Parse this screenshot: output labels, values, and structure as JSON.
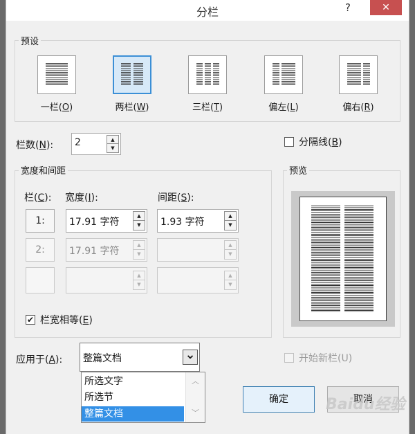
{
  "window": {
    "title": "分栏",
    "help_icon": "?",
    "close_icon": "✕"
  },
  "presets": {
    "group_label": "预设",
    "items": [
      {
        "label": "一栏(",
        "key": "O",
        "suffix": ")"
      },
      {
        "label": "两栏(",
        "key": "W",
        "suffix": ")"
      },
      {
        "label": "三栏(",
        "key": "T",
        "suffix": ")"
      },
      {
        "label": "偏左(",
        "key": "L",
        "suffix": ")"
      },
      {
        "label": "偏右(",
        "key": "R",
        "suffix": ")"
      }
    ],
    "selected": "两栏"
  },
  "columns_count": {
    "label": "栏数(",
    "key": "N",
    "suffix": "):",
    "value": "2"
  },
  "divider": {
    "label": "分隔线(",
    "key": "B",
    "suffix": ")",
    "checked": false
  },
  "width_spacing": {
    "group_label": "宽度和间距",
    "col_header": {
      "label": "栏(",
      "key": "C",
      "suffix": "):"
    },
    "width_header": {
      "label": "宽度(",
      "key": "I",
      "suffix": "):"
    },
    "spacing_header": {
      "label": "间距(",
      "key": "S",
      "suffix": "):"
    },
    "rows": [
      {
        "num": "1:",
        "width": "17.91 字符",
        "spacing": "1.93 字符"
      },
      {
        "num": "2:",
        "width": "17.91 字符",
        "spacing": ""
      },
      {
        "num": "",
        "width": "",
        "spacing": ""
      }
    ]
  },
  "equal_width": {
    "label": "栏宽相等(",
    "key": "E",
    "suffix": ")",
    "checked": true,
    "check_glyph": "✔"
  },
  "preview": {
    "label": "预览"
  },
  "apply_to": {
    "label": "应用于(",
    "key": "A",
    "suffix": "):",
    "value": "整篇文档",
    "options": [
      "所选文字",
      "所选节",
      "整篇文档"
    ],
    "arrow_glyph": "⌄"
  },
  "new_column": {
    "label": "开始新栏(U)",
    "checked": false
  },
  "buttons": {
    "ok": "确定",
    "cancel": "取消"
  },
  "watermark": "Baidu经验"
}
